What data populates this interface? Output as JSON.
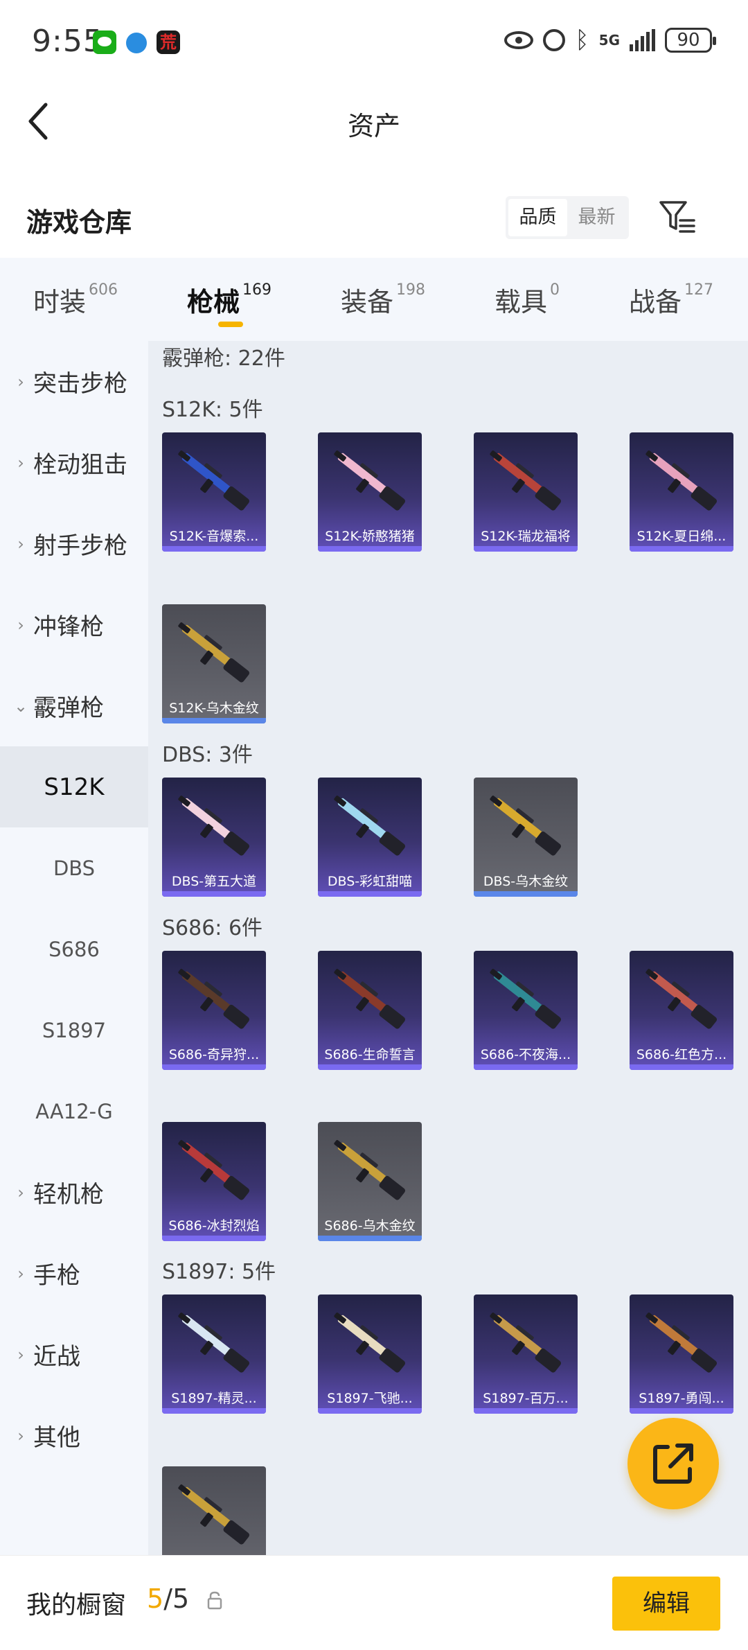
{
  "status_bar": {
    "time": "9:55",
    "network": "5G",
    "battery": "90"
  },
  "nav": {
    "title": "资产"
  },
  "section": {
    "title": "游戏仓库",
    "sort_options": [
      "品质",
      "最新"
    ],
    "sort_active": "品质"
  },
  "tabs": [
    {
      "label": "时装",
      "count": "606"
    },
    {
      "label": "枪械",
      "count": "169"
    },
    {
      "label": "装备",
      "count": "198"
    },
    {
      "label": "载具",
      "count": "0"
    },
    {
      "label": "战备",
      "count": "127"
    }
  ],
  "active_tab": "枪械",
  "sidebar": {
    "categories": [
      "突击步枪",
      "栓动狙击",
      "射手步枪",
      "冲锋枪",
      "霰弹枪"
    ],
    "expanded": "霰弹枪",
    "subcategories": [
      "S12K",
      "DBS",
      "S686",
      "S1897",
      "AA12-G"
    ],
    "active_sub": "S12K",
    "categories_after": [
      "轻机枪",
      "手枪",
      "近战",
      "其他"
    ]
  },
  "content": {
    "category_header": "霰弹枪: 22件",
    "groups": [
      {
        "header": "S12K: 5件",
        "items": [
          {
            "name": "S12K-音爆索...",
            "rarity": "purple",
            "color": "#2f55c8"
          },
          {
            "name": "S12K-娇憨猪猪",
            "rarity": "purple",
            "color": "#f0b8cf"
          },
          {
            "name": "S12K-瑞龙福将",
            "rarity": "purple",
            "color": "#b8443a"
          },
          {
            "name": "S12K-夏日绵...",
            "rarity": "purple",
            "color": "#e7a2bd"
          },
          {
            "name": "S12K-乌木金纹",
            "rarity": "gray",
            "color": "#c9a13a"
          }
        ]
      },
      {
        "header": "DBS: 3件",
        "items": [
          {
            "name": "DBS-第五大道",
            "rarity": "purple",
            "color": "#f2d2de"
          },
          {
            "name": "DBS-彩虹甜喵",
            "rarity": "purple",
            "color": "#9fd8ef"
          },
          {
            "name": "DBS-乌木金纹",
            "rarity": "gray",
            "color": "#d8aa2e"
          }
        ]
      },
      {
        "header": "S686: 6件",
        "items": [
          {
            "name": "S686-奇异狩...",
            "rarity": "purple",
            "color": "#5a3a2a"
          },
          {
            "name": "S686-生命誓言",
            "rarity": "purple",
            "color": "#8a3a2a"
          },
          {
            "name": "S686-不夜海...",
            "rarity": "purple",
            "color": "#2f8a94"
          },
          {
            "name": "S686-红色方...",
            "rarity": "purple",
            "color": "#c25a4e"
          },
          {
            "name": "S686-冰封烈焰",
            "rarity": "purple",
            "color": "#b83a3a"
          },
          {
            "name": "S686-乌木金纹",
            "rarity": "gray",
            "color": "#c9a13a"
          }
        ]
      },
      {
        "header": "S1897: 5件",
        "items": [
          {
            "name": "S1897-精灵...",
            "rarity": "purple",
            "color": "#d8e6f2"
          },
          {
            "name": "S1897-飞驰...",
            "rarity": "purple",
            "color": "#e8dcc0"
          },
          {
            "name": "S1897-百万...",
            "rarity": "purple",
            "color": "#c69a4a"
          },
          {
            "name": "S1897-勇闯...",
            "rarity": "purple",
            "color": "#c07a3a"
          },
          {
            "name": "",
            "rarity": "gray",
            "color": "#c9a13a"
          }
        ]
      }
    ]
  },
  "bottom_bar": {
    "label": "我的橱窗",
    "count_current": "5",
    "count_total": "/5",
    "edit_label": "编辑"
  },
  "colors": {
    "accent": "#fbc10b",
    "tab_underline": "#f6b400",
    "fab": "#fbb617"
  }
}
